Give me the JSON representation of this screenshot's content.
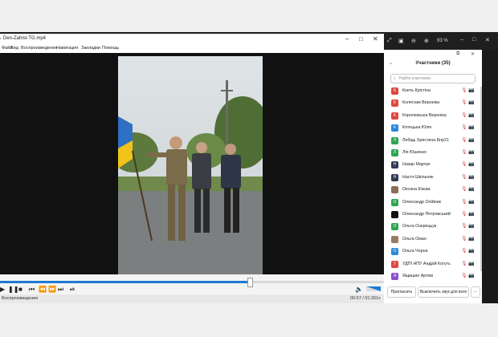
{
  "player": {
    "title": "Den-Zahist-TG.mp4",
    "menu": [
      "Файл",
      "Вид",
      "Воспроизведение",
      "Навигация",
      "Закладки",
      "Помощь"
    ],
    "status_left": "Воспроизведение",
    "time": "00:57 / 01:26",
    "speed": "1x",
    "progress": 0.66
  },
  "zoom_toolbar": {
    "zoom_level": "93 %"
  },
  "participants_panel": {
    "title": "Участники (35)",
    "search_placeholder": "Найти участника",
    "participants": [
      {
        "initial": "К",
        "name": "Книть Крістіна",
        "color": "#e0463f"
      },
      {
        "initial": "К",
        "name": "Колесник Вероніка",
        "color": "#e0463f"
      },
      {
        "initial": "К",
        "name": "Королевська Вероніка",
        "color": "#e0463f"
      },
      {
        "initial": "К",
        "name": "Котецька Юлія",
        "color": "#2b88d8"
      },
      {
        "initial": "Л",
        "name": "Лебідь Христина Бпр21",
        "color": "#2ea44f"
      },
      {
        "initial": "Л",
        "name": "Лія Юшенко",
        "color": "#2ea44f"
      },
      {
        "initial": "Н",
        "name": "Назар Марчук",
        "color": "#2f3a52"
      },
      {
        "initial": "Н",
        "name": "Настя Шкільняк",
        "color": "#2f3a52"
      },
      {
        "initial": "",
        "name": "Оксана Кізєва",
        "color": "#8a6d5a"
      },
      {
        "initial": "О",
        "name": "Олександр Олійник",
        "color": "#2ea44f"
      },
      {
        "initial": "",
        "name": "Олександр Петровський",
        "color": "#111111"
      },
      {
        "initial": "О",
        "name": "Ольга Озерецьук",
        "color": "#2ea44f"
      },
      {
        "initial": "",
        "name": "Ольга Оман",
        "color": "#9a7b5f"
      },
      {
        "initial": "О",
        "name": "Ольга Чорна",
        "color": "#2b88d8"
      },
      {
        "initial": "У",
        "name": "УДПІ НПУ Андрій Когуть",
        "color": "#e0463f"
      },
      {
        "initial": "Я",
        "name": "Ящишин Артем",
        "color": "#8a4fd1"
      }
    ],
    "invite_label": "Пригласить",
    "mute_all_label": "Выключить звук для всех"
  }
}
